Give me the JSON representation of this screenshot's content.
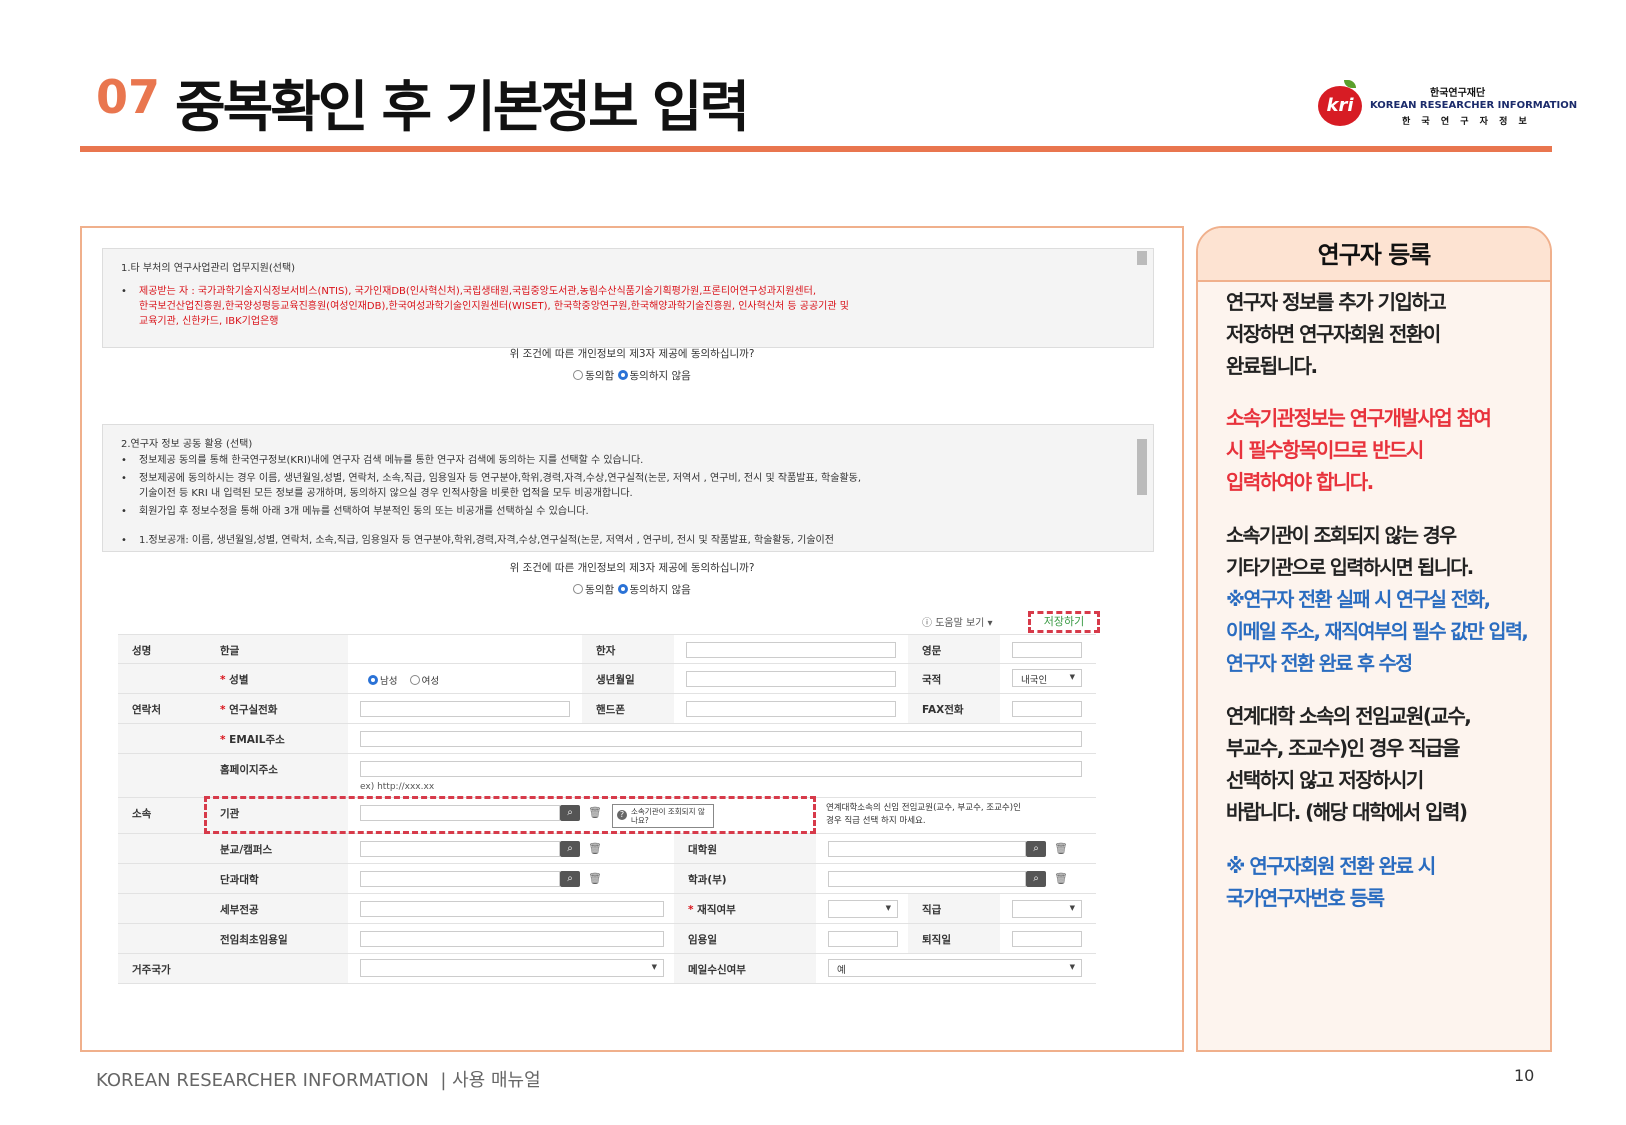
{
  "header": {
    "number": "07",
    "title": "중복확인 후 기본정보 입력"
  },
  "logo": {
    "badge": "kri",
    "line1": "한국연구재단",
    "line2": "KOREAN RESEARCHER INFORMATION",
    "line3": "한 국 연 구 자 정 보"
  },
  "sec1": {
    "heading": "1.타 부처의 연구사업관리 업무지원(선택)",
    "red1": "제공받는 자 : 국가과학기술지식정보서비스(NTIS), 국가인재DB(인사혁신처),국립생태원,국립중앙도서관,농림수산식품기술기획평가원,프론티어연구성과지원센터,",
    "red2": "한국보건산업진흥원,한국양성평등교육진흥원(여성인재DB),한국여성과학기술인지원센터(WISET), 한국학중앙연구원,한국해양과학기술진흥원, 인사혁신처 등 공공기관 및",
    "red3": "교육기관, 신한카드, IBK기업은행"
  },
  "question": "위 조건에 따른 개인정보의 제3자 제공에 동의하십니까?",
  "agree": "동의함",
  "disagree": "동의하지 않음",
  "sec2": {
    "heading": "2.연구자 정보 공동 활용 (선택)",
    "i1": "정보제공 동의를 통해 한국연구정보(KRI)내에 연구자 검색 메뉴를 통한 연구자 검색에 동의하는 지를 선택할 수 있습니다.",
    "i2a": "정보제공에 동의하시는 경우 이름, 생년월일,성별, 연락처, 소속,직급, 임용일자 등 연구분야,학위,경력,자격,수상,연구실적(논문, 저역서 , 연구비, 전시 및 작품발표, 학술활동,",
    "i2b": "기술이전 등 KRI 내 입력된 모든 정보를 공개하며, 동의하지 않으실 경우 인적사항을 비롯한 업적을 모두 비공개합니다.",
    "i3": "회원가입 후 정보수정을 통해 아래 3개 메뉴를 선택하여 부분적인 동의 또는 비공개를 선택하실 수 있습니다.",
    "i4": "1.정보공개: 이름, 생년월일,성별, 연락처, 소속,직급, 임용일자 등 연구분야,학위,경력,자격,수상,연구실적(논문, 저역서 , 연구비, 전시 및 작품발표, 학술활동, 기술이전"
  },
  "toolbar": {
    "help": "도움말 보기",
    "save": "저장하기"
  },
  "form": {
    "name": "성명",
    "korean": "한글",
    "hanja": "한자",
    "english": "영문",
    "gender": "성별",
    "male": "남성",
    "female": "여성",
    "birth": "생년월일",
    "nation": "국적",
    "nation_val": "내국인",
    "contact": "연락처",
    "labphone": "연구실전화",
    "mobile": "핸드폰",
    "fax": "FAX전화",
    "email": "EMAIL주소",
    "homepage": "홈페이지주소",
    "homepage_hint": "ex) http://xxx.xx",
    "affil": "소속",
    "org": "기관",
    "org_help": "소속기관이 조회되지 않나요?",
    "org_note1": "연계대학소속의 신임 전임교원(교수, 부교수, 조교수)인",
    "org_note2": "경우 직급 선택 하지 마세요.",
    "branch": "분교/캠퍼스",
    "grad": "대학원",
    "college": "단과대학",
    "dept": "학과(부)",
    "major": "세부전공",
    "employed": "재직여부",
    "rank": "직급",
    "firstdate": "전임최초임용일",
    "appoint": "임용일",
    "retire": "퇴직일",
    "country": "거주국가",
    "mailrecv": "메일수신여부",
    "mail_val": "예"
  },
  "right": {
    "title": "연구자 등록",
    "p1a": "연구자 정보를 추가 기입하고",
    "p1b": "저장하면 연구자회원 전환이",
    "p1c": "완료됩니다.",
    "p2a": "소속기관정보는 연구개발사업 참여",
    "p2b": "시 필수항목이므로 반드시",
    "p2c": "입력하여야 합니다.",
    "p3a": "소속기관이 조회되지 않는 경우",
    "p3b": "기타기관으로 입력하시면 됩니다.",
    "p3c": "※연구자 전환 실패 시 연구실 전화,",
    "p3d": "이메일 주소, 재직여부의 필수 값만 입력,",
    "p3e": "연구자 전환 완료 후 수정",
    "p4a": "연계대학 소속의 전임교원(교수,",
    "p4b": "부교수, 조교수)인 경우 직급을",
    "p4c": "선택하지 않고 저장하시기",
    "p4d": "바랍니다. (해당 대학에서 입력)",
    "p5a": "※ 연구자회원 전환 완료 시",
    "p5b": "국가연구자번호 등록"
  },
  "footer": {
    "brand": "KOREAN RESEARCHER INFORMATION",
    "sep": "|",
    "manual": "사용 매뉴얼",
    "page": "10"
  }
}
